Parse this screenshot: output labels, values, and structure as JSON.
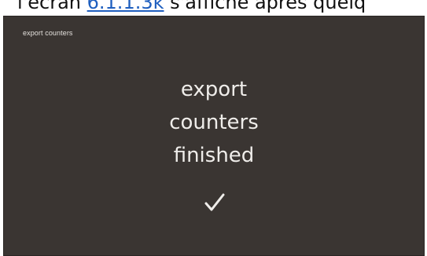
{
  "caption": {
    "prefix": "l'écran ",
    "link": "6.1.1.3k",
    "suffix": " s'affiche après quelq"
  },
  "screen": {
    "title": "export counters",
    "message_lines": [
      "export",
      "counters",
      "finished"
    ],
    "status_icon": "checkmark-icon",
    "colors": {
      "background": "#3a3532",
      "text": "#efedea"
    }
  }
}
